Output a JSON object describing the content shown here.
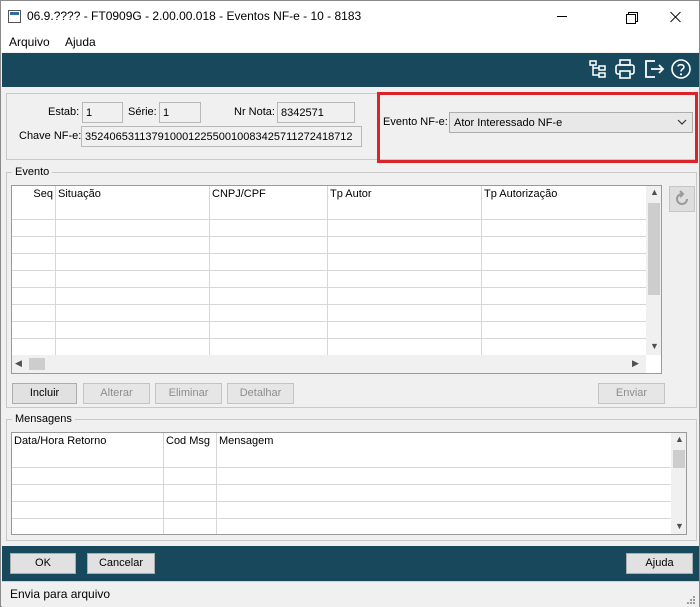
{
  "window": {
    "title": "06.9.???? - FT0909G - 2.00.00.018 - Eventos NF-e - 10 - 8183"
  },
  "menu": {
    "items": [
      "Arquivo",
      "Ajuda"
    ]
  },
  "toolbar": {
    "icons": [
      "tree-icon",
      "print-icon",
      "exit-icon",
      "help-icon"
    ]
  },
  "header": {
    "estab_label": "Estab:",
    "estab_value": "1",
    "serie_label": "Série:",
    "serie_value": "1",
    "nr_nota_label": "Nr Nota:",
    "nr_nota_value": "8342571",
    "chave_label": "Chave NF-e:",
    "chave_value": "35240653113791000122550010083425711272418712",
    "evento_label": "Evento NF-e:",
    "evento_value": "Ator Interessado NF-e"
  },
  "evento_section": {
    "title": "Evento",
    "columns": [
      "Seq",
      "Situação",
      "CNPJ/CPF",
      "Tp Autor",
      "Tp Autorização"
    ],
    "buttons": {
      "incluir": "Incluir",
      "alterar": "Alterar",
      "eliminar": "Eliminar",
      "detalhar": "Detalhar",
      "enviar": "Enviar"
    }
  },
  "mensagens_section": {
    "title": "Mensagens",
    "columns": [
      "Data/Hora Retorno",
      "Cod Msg",
      "Mensagem"
    ]
  },
  "footer": {
    "ok": "OK",
    "cancelar": "Cancelar",
    "ajuda": "Ajuda"
  },
  "status": {
    "text": "Envia para arquivo"
  },
  "colors": {
    "toolbar_bg": "#17485c",
    "highlight": "#d9252a"
  }
}
